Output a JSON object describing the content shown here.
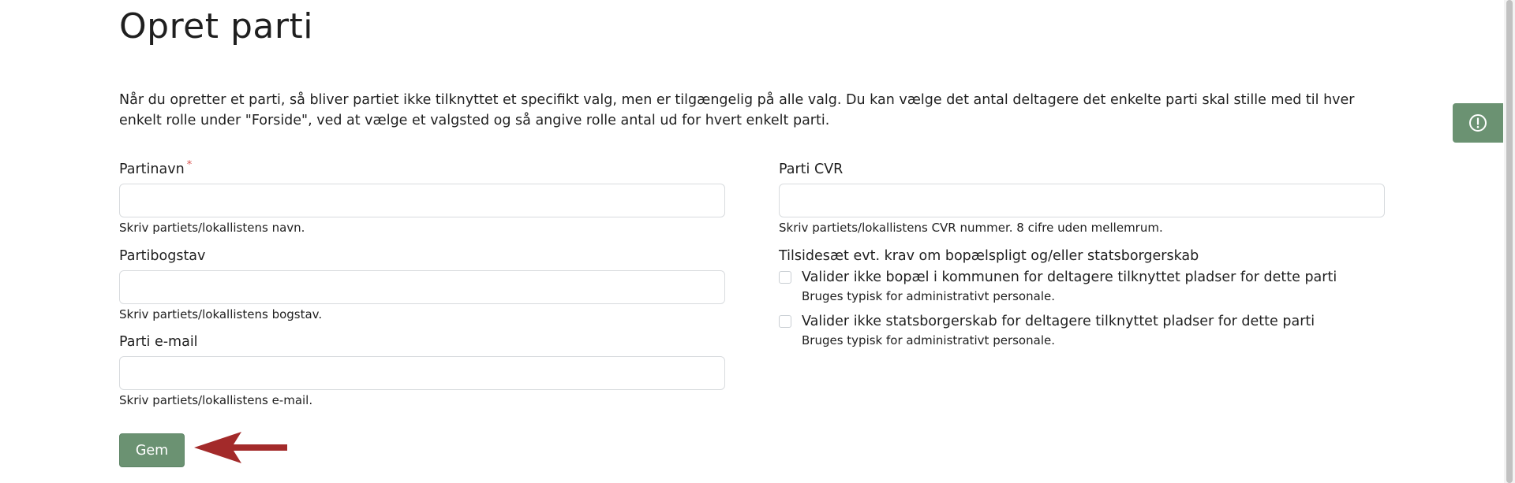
{
  "page": {
    "title": "Opret parti",
    "intro": "Når du opretter et parti, så bliver partiet ikke tilknyttet et specifikt valg, men er tilgængelig på alle valg. Du kan vælge det antal deltagere det enkelte parti skal stille med til hver enkelt rolle under \"Forside\", ved at vælge et valgsted og så angive rolle antal ud for hvert enkelt parti."
  },
  "form": {
    "party_name": {
      "label": "Partinavn",
      "required_mark": "*",
      "value": "",
      "help": "Skriv partiets/lokallistens navn."
    },
    "party_letter": {
      "label": "Partibogstav",
      "value": "",
      "help": "Skriv partiets/lokallistens bogstav."
    },
    "party_email": {
      "label": "Parti e-mail",
      "value": "",
      "help": "Skriv partiets/lokallistens e-mail."
    },
    "party_cvr": {
      "label": "Parti CVR",
      "value": "",
      "help": "Skriv partiets/lokallistens CVR nummer. 8 cifre uden mellemrum."
    },
    "override_group_label": "Tilsidesæt evt. krav om bopælspligt og/eller statsborgerskab",
    "checkboxes": [
      {
        "label": "Valider ikke bopæl i kommunen for deltagere tilknyttet pladser for dette parti",
        "help": "Bruges typisk for administrativt personale.",
        "checked": false
      },
      {
        "label": "Valider ikke statsborgerskab for deltagere tilknyttet pladser for dette parti",
        "help": "Bruges typisk for administrativt personale.",
        "checked": false
      }
    ],
    "save_label": "Gem"
  },
  "feedback_tab": {
    "icon": "alert-circle-icon"
  },
  "colors": {
    "accent": "#6b9272",
    "required": "#d9534f",
    "arrow": "#a32a2a"
  }
}
